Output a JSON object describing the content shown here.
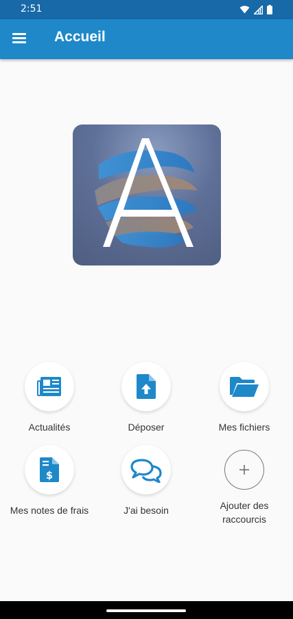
{
  "status_bar": {
    "time": "2:51",
    "icons": [
      "wifi-icon",
      "signal-icon",
      "battery-icon"
    ]
  },
  "app_bar": {
    "title": "Accueil",
    "menu_icon": "hamburger-menu-icon"
  },
  "logo": {
    "letter": "A"
  },
  "shortcuts": [
    {
      "label": "Actualités",
      "icon": "newspaper-icon"
    },
    {
      "label": "Déposer",
      "icon": "file-upload-icon"
    },
    {
      "label": "Mes fichiers",
      "icon": "folder-open-icon"
    },
    {
      "label": "Mes notes de frais",
      "icon": "expense-receipt-icon"
    },
    {
      "label": "J'ai besoin",
      "icon": "chat-bubbles-icon"
    },
    {
      "label": "Ajouter des raccourcis",
      "icon": "plus-icon"
    }
  ],
  "colors": {
    "status_bar": "#1869a8",
    "app_bar": "#1e88c9",
    "icon_blue": "#1e88c9",
    "background": "#fafafa"
  }
}
